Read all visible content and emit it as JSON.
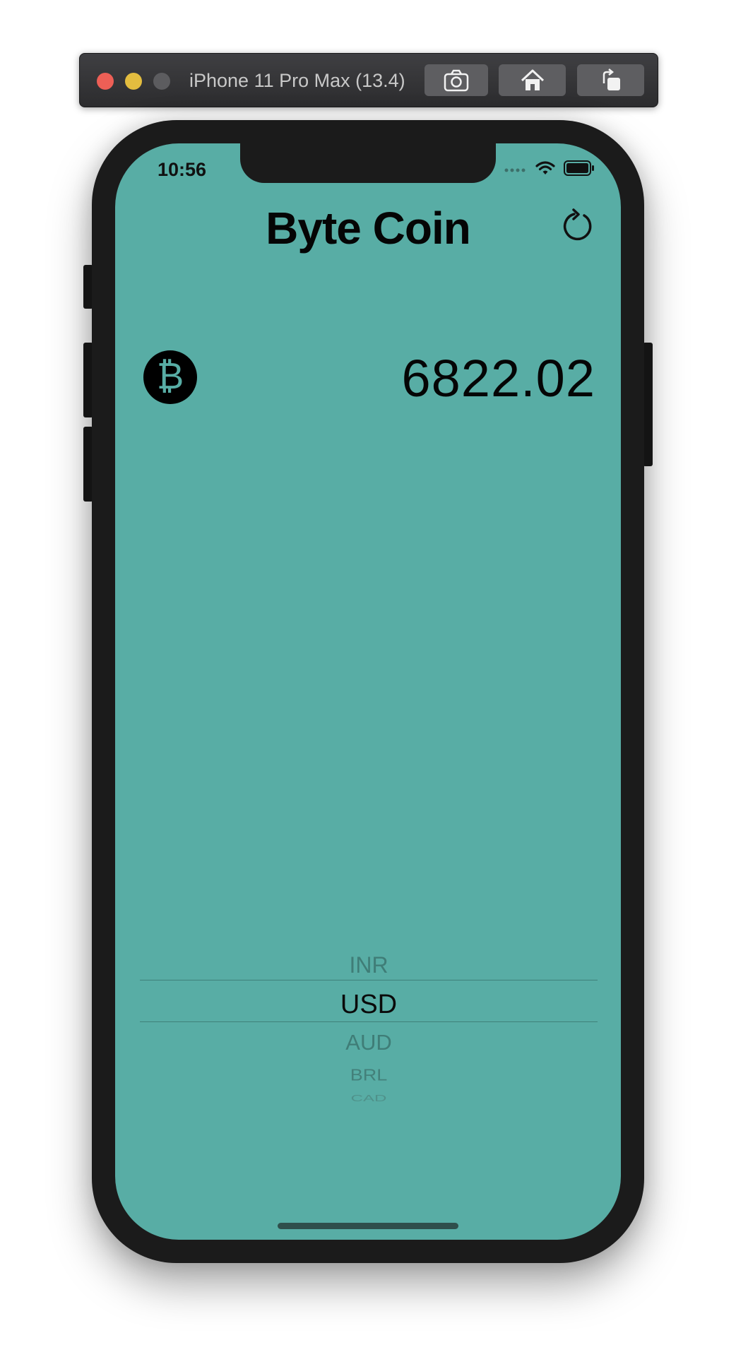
{
  "window": {
    "title": "iPhone 11 Pro Max (13.4)"
  },
  "toolbar": {
    "screenshot_icon": "camera-icon",
    "home_icon": "home-icon",
    "rotate_icon": "rotate-icon"
  },
  "status_bar": {
    "time": "10:56"
  },
  "app": {
    "title": "Byte Coin",
    "refresh_icon": "refresh-icon",
    "coin_icon": "bitcoin-icon",
    "coin_symbol": "₿",
    "price": "6822.02"
  },
  "picker": {
    "previous": "INR",
    "selected": "USD",
    "next": [
      "AUD",
      "BRL",
      "CAD"
    ]
  },
  "colors": {
    "background": "#58ada5",
    "text": "#050505"
  }
}
